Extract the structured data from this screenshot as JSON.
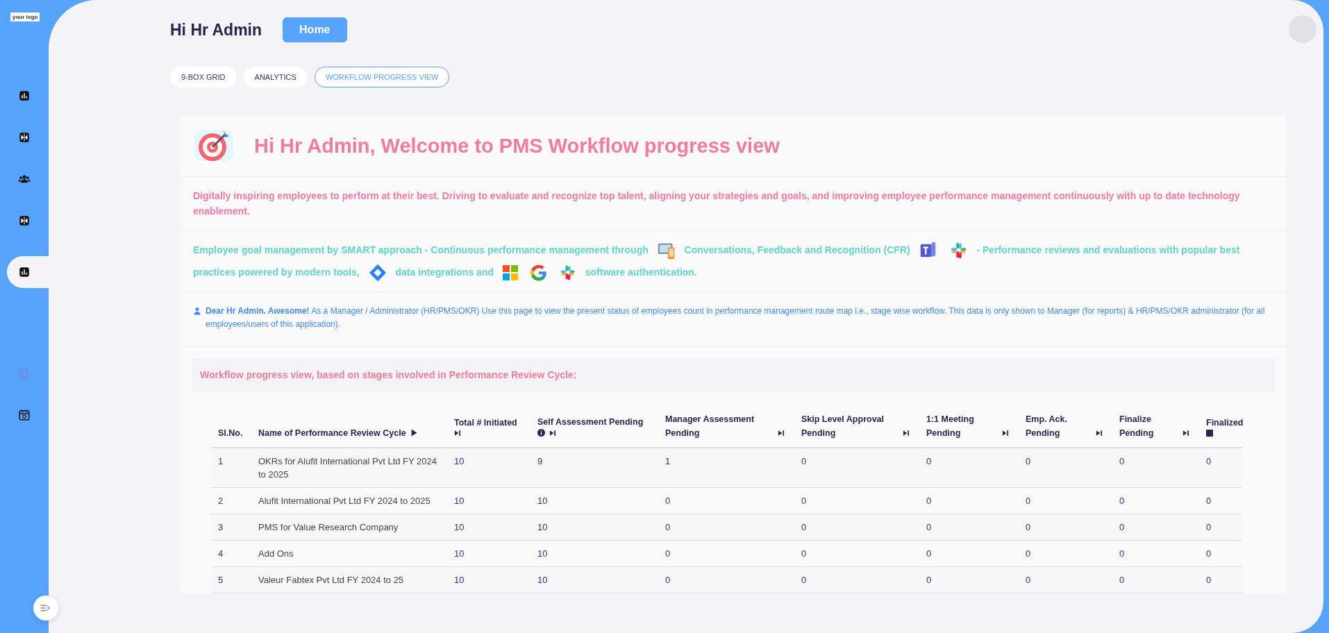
{
  "sidebar": {
    "logo": "your logo",
    "items": [
      {
        "selected": false,
        "disabled": false
      },
      {
        "selected": false,
        "disabled": false
      },
      {
        "selected": false,
        "disabled": false
      },
      {
        "selected": false,
        "disabled": false
      },
      {
        "selected": true,
        "disabled": false
      }
    ],
    "lower_items": [
      {
        "selected": false,
        "disabled": true
      },
      {
        "selected": false,
        "disabled": false
      }
    ]
  },
  "header": {
    "greeting": "Hi Hr Admin",
    "home_button": "Home"
  },
  "tabs": [
    {
      "label": "9-BOX GRID",
      "selected": false
    },
    {
      "label": "ANALYTICS",
      "selected": false
    },
    {
      "label": "WORKFLOW PROGRESS VIEW",
      "selected": true
    }
  ],
  "welcome": {
    "title": "Hi Hr Admin, Welcome to PMS Workflow progress view",
    "intro": "Digitally inspiring employees to perform at their best. Driving to evaluate and recognize top talent, aligning your strategies and goals, and improving employee performance management continuously with up to date technology enablement.",
    "goal_parts": [
      "Employee goal management by SMART approach - Continuous performance management through",
      "Conversations, Feedback and Recognition (CFR)",
      "- Performance reviews and evaluations with popular best",
      "practices powered by modern tools,",
      "data integrations and",
      "software authentication."
    ],
    "note": "**Dear Hr Admin. Awesome!** As a Manager / Administrator (HR/PMS/OKR) Use this page to view the present status of employees count in performance management route map i.e., stage wise workflow. This data is only shown to Manager (for reports) & HR/PMS/OKR administrator (for all employees/users of this application)."
  },
  "table": {
    "heading": "Workflow progress view, based on stages involved in Performance Review Cycle:",
    "columns": [
      "Sl.No.",
      "Name of Performance Review Cycle",
      "Total # Initiated",
      "Self Assessment Pending",
      "Manager Assessment Pending",
      "Skip Level Approval Pending",
      "1:1 Meeting Pending",
      "Emp. Ack. Pending",
      "Finalize Pending",
      "Finalized"
    ],
    "rows": [
      [
        "1",
        "OKRs for Alufit International Pvt Ltd FY 2024 to 2025",
        "10",
        "9",
        "1",
        "0",
        "0",
        "0",
        "0",
        "0"
      ],
      [
        "2",
        "Alufit International Pvt Ltd FY 2024 to 2025",
        "10",
        "10",
        "0",
        "0",
        "0",
        "0",
        "0",
        "0"
      ],
      [
        "3",
        "PMS for Value Research Company",
        "10",
        "10",
        "0",
        "0",
        "0",
        "0",
        "0",
        "0"
      ],
      [
        "4",
        "Add Ons",
        "10",
        "10",
        "0",
        "0",
        "0",
        "0",
        "0",
        "0"
      ],
      [
        "5",
        "Valeur Fabtex Pvt Ltd FY 2024 to 25",
        "10",
        "10",
        "0",
        "0",
        "0",
        "0",
        "0",
        "0"
      ]
    ]
  }
}
